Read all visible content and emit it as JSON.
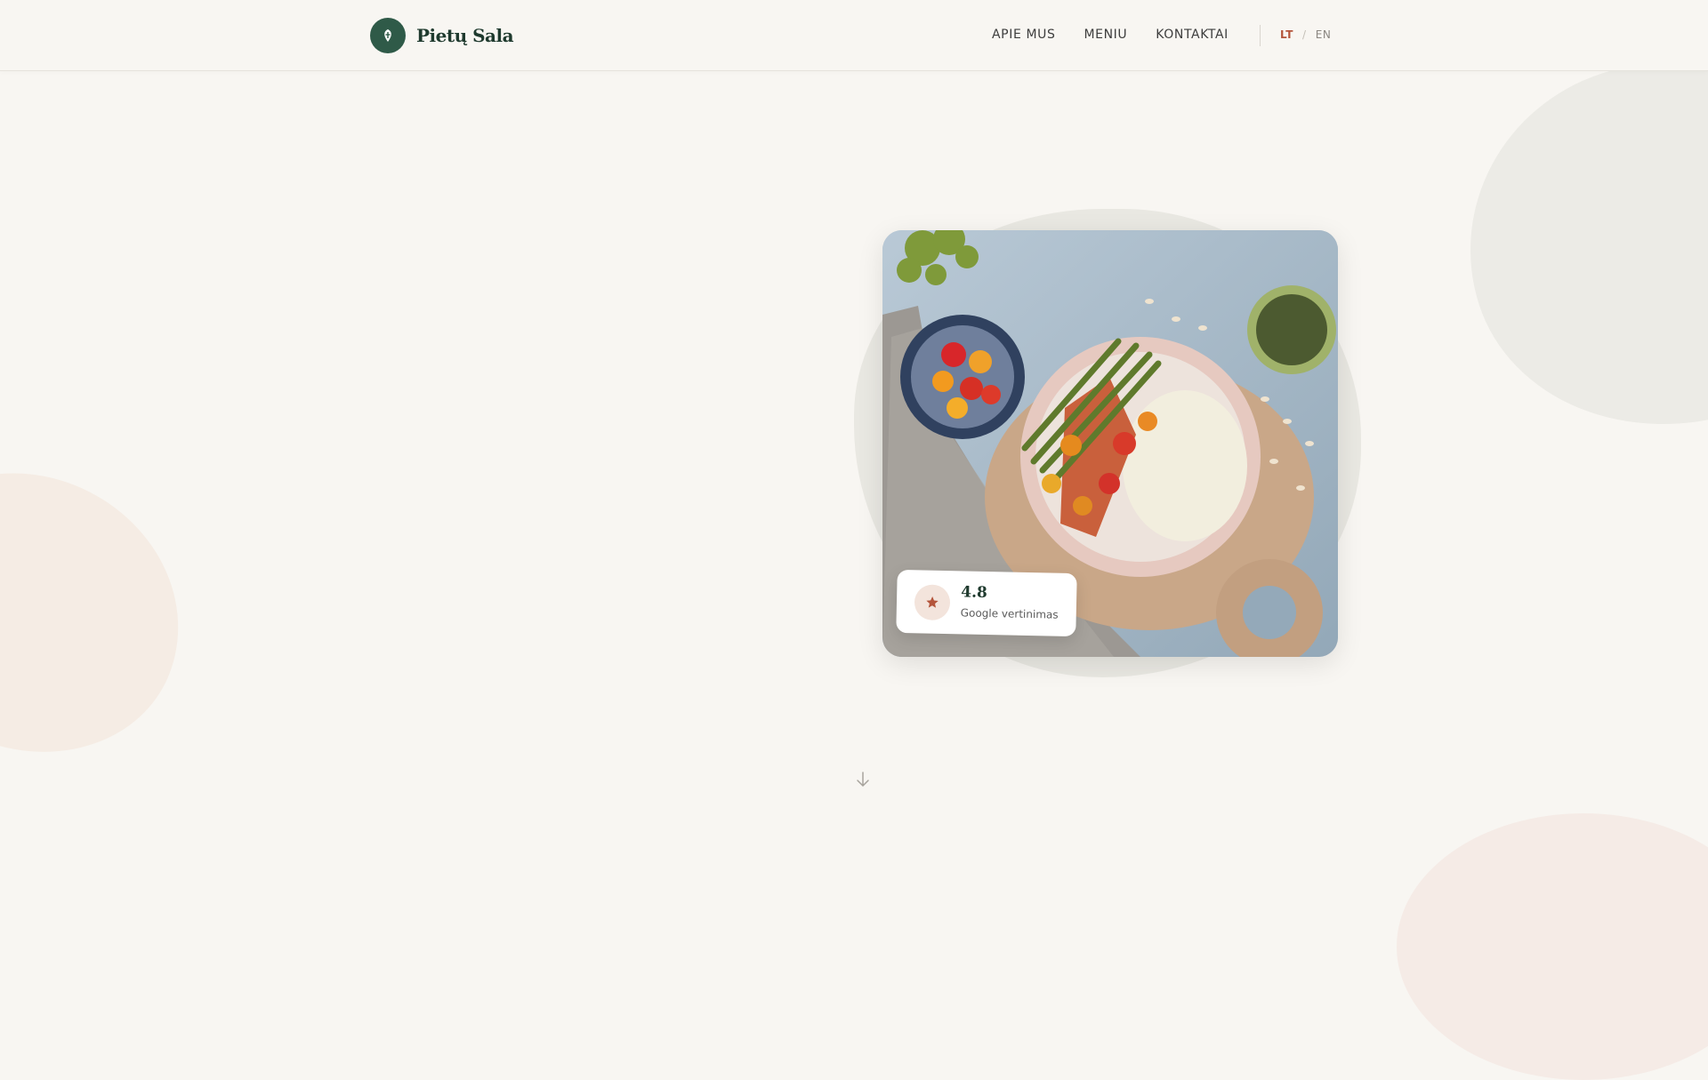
{
  "brand": {
    "name": "Pietų Sala"
  },
  "nav": {
    "items": [
      {
        "label": "APIE MUS"
      },
      {
        "label": "MENIU"
      },
      {
        "label": "KONTAKTAI"
      }
    ]
  },
  "lang": {
    "active": "LT",
    "separator": "/",
    "inactive": "EN"
  },
  "rating": {
    "value": "4.8",
    "label": "Google vertinimas"
  },
  "colors": {
    "background": "#f8f6f2",
    "brand_green": "#2f5a48",
    "accent": "#b4553b"
  },
  "icons": {
    "logo": "leaf-in-circle-icon",
    "rating": "star-icon",
    "scroll": "arrow-down-icon"
  }
}
